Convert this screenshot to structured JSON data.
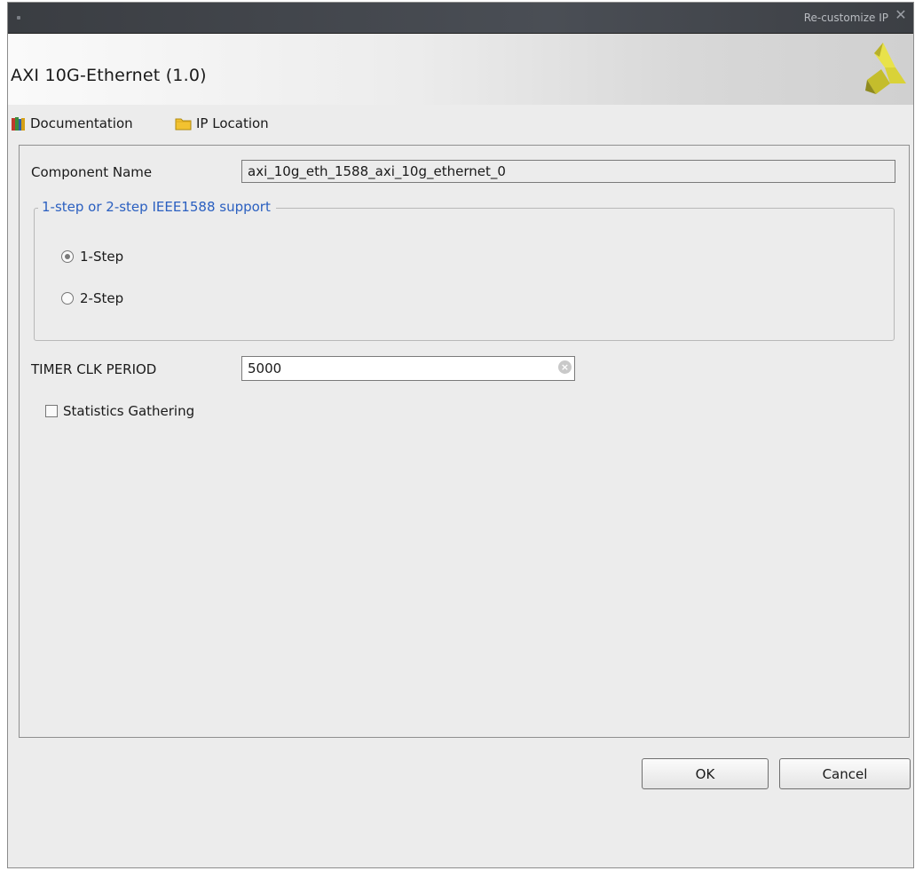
{
  "window": {
    "title": "Re-customize IP"
  },
  "header": {
    "ip_title": "AXI 10G-Ethernet (1.0)",
    "logo_icon": "xilinx-logo-icon"
  },
  "toolbar": {
    "documentation_label": "Documentation",
    "documentation_icon": "books-icon",
    "ip_location_label": "IP Location",
    "ip_location_icon": "folder-icon"
  },
  "form": {
    "component_name_label": "Component Name",
    "component_name_value": "axi_10g_eth_1588_axi_10g_ethernet_0",
    "ieee1588_group_title": "1-step or 2-step IEEE1588 support",
    "ieee1588_options": [
      {
        "label": "1-Step",
        "selected": true
      },
      {
        "label": "2-Step",
        "selected": false
      }
    ],
    "timer_clk_period_label": "TIMER CLK PERIOD",
    "timer_clk_period_value": "5000",
    "statistics_gathering_label": "Statistics Gathering",
    "statistics_gathering_checked": false
  },
  "buttons": {
    "ok_label": "OK",
    "cancel_label": "Cancel"
  },
  "colors": {
    "group_title": "#2a5fc0",
    "titlebar": "#3f4247"
  }
}
